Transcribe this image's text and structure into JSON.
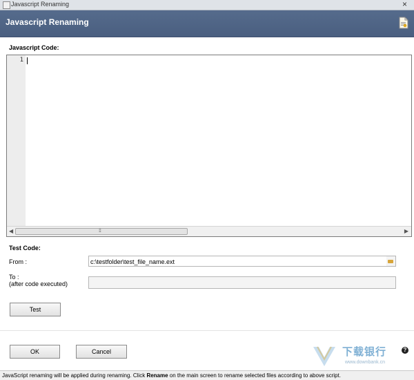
{
  "window": {
    "title": "Javascript Renaming",
    "close_glyph": "×"
  },
  "header": {
    "title": "Javascript Renaming",
    "icon": "document-script-icon"
  },
  "editor": {
    "label": "Javascript Code:",
    "line_number": "1",
    "grip": "⁞⁞⁞"
  },
  "test": {
    "section_label": "Test Code:",
    "from_label": "From :",
    "from_value": "c:\\testfolder\\test_file_name.ext",
    "to_label": "To :",
    "to_sublabel": "(after code executed)",
    "to_value": "",
    "test_button": "Test"
  },
  "footer": {
    "ok_button": "OK",
    "cancel_button": "Cancel",
    "help_glyph": "?"
  },
  "watermark": {
    "text": "下载银行",
    "url": "www.downbank.cn"
  },
  "status": {
    "before": "JavaScript renaming will be applied during renaming. Click ",
    "bold": "Rename",
    "after": " on the main screen to rename selected files according to above script."
  },
  "colors": {
    "header_bg": "#4f6486",
    "accent": "#4a5f80"
  }
}
